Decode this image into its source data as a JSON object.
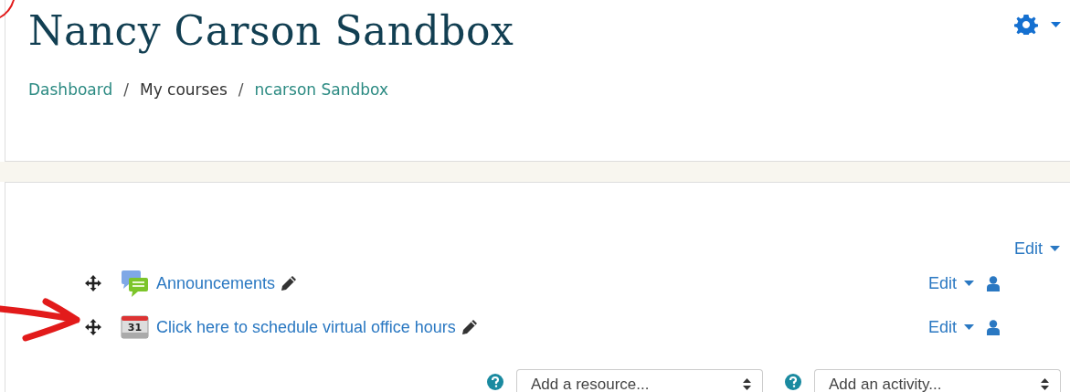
{
  "page": {
    "title": "Nancy Carson Sandbox",
    "breadcrumb": [
      {
        "kind": "link",
        "label": "Dashboard"
      },
      {
        "kind": "separator",
        "label": "/"
      },
      {
        "kind": "text",
        "label": "My courses"
      },
      {
        "kind": "separator",
        "label": "/"
      },
      {
        "kind": "link",
        "label": "ncarson Sandbox"
      }
    ]
  },
  "section": {
    "edit_label": "Edit",
    "activities": [
      {
        "kind": "forum",
        "name": "Announcements",
        "edit_label": "Edit"
      },
      {
        "kind": "calendar",
        "name": "Click here to schedule virtual office hours",
        "edit_label": "Edit",
        "icon_text": "31"
      }
    ],
    "selects": [
      {
        "value": "Add a resource..."
      },
      {
        "value": "Add an activity..."
      }
    ]
  }
}
